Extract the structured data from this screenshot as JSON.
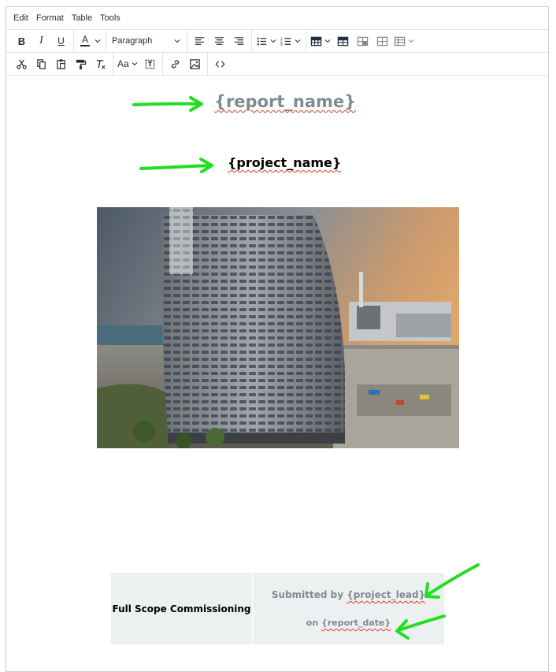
{
  "menubar": {
    "items": [
      "Edit",
      "Format",
      "Table",
      "Tools"
    ]
  },
  "toolbar": {
    "block_format": "Paragraph",
    "row1_icons": [
      "bold-icon",
      "italic-icon",
      "underline-icon",
      "text-color-icon",
      "align-left-icon",
      "align-center-icon",
      "align-right-icon",
      "bullet-list-icon",
      "numbered-list-icon",
      "table-icon",
      "table-props-icon",
      "table-cell-props-icon",
      "table-row-icon",
      "table-col-icon"
    ],
    "row2_icons": [
      "cut-icon",
      "copy-icon",
      "paste-icon",
      "format-painter-icon",
      "clear-format-icon",
      "font-size-icon",
      "paste-text-icon",
      "link-icon",
      "image-icon",
      "code-icon"
    ],
    "bold_label": "B",
    "italic_label": "I",
    "underline_label": "U",
    "text_color_label": "A",
    "font_size_label": "Aa"
  },
  "content": {
    "report_name": "{report_name}",
    "project_name": "{project_name}",
    "table": {
      "left_cell": "Full Scope Commissioning",
      "submitted_prefix": "Submitted by ",
      "submitted_var": "{project_lead}",
      "on_prefix": "on ",
      "on_var": "{report_date}"
    }
  },
  "colors": {
    "arrow": "#22dd22",
    "grey_text": "#7e8c8d",
    "table_bg": "#ecf0f1"
  }
}
